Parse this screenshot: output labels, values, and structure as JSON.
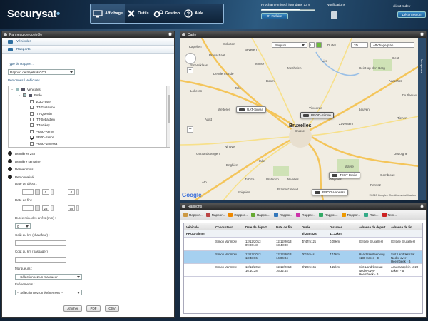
{
  "header": {
    "logo": "Securysat",
    "nav": {
      "display": "Affichage",
      "tools": "Outils",
      "manage": "Gestion",
      "help": "Aide"
    },
    "progress_text": "Prochaine mise à jour dans 13 s",
    "progress_fraction": 0.72,
    "reload_label": "Refaire",
    "notifications_label": "Notifications",
    "client_label": "client mdev",
    "logout_label": "Déconnexion"
  },
  "left_panel": {
    "title": "Panneau de contrôle",
    "vehicles_tab": "Véhicules",
    "reports_tab": "Rapports",
    "report_type_label": "Type de Rapport :",
    "report_type_value": "Rapport de trajets & CO2",
    "people_label": "Personnes / Véhicules :",
    "tree": [
      {
        "label": "Véhicules",
        "level": 0,
        "check": "part",
        "toggle": "-"
      },
      {
        "label": "Emile",
        "level": 1,
        "check": "part",
        "toggle": "-"
      },
      {
        "label": "103OTester",
        "level": 2,
        "check": "off",
        "toggle": ""
      },
      {
        "label": "ITT-Guillaume",
        "level": 2,
        "check": "off",
        "toggle": ""
      },
      {
        "label": "ITT-Quentin",
        "level": 2,
        "check": "off",
        "toggle": ""
      },
      {
        "label": "ITT-Sébastien",
        "level": 2,
        "check": "off",
        "toggle": ""
      },
      {
        "label": "ITT-Valery",
        "level": 2,
        "check": "off",
        "toggle": ""
      },
      {
        "label": "PROD-Remy",
        "level": 2,
        "check": "off",
        "toggle": ""
      },
      {
        "label": "PROD-Simon",
        "level": 2,
        "check": "on",
        "toggle": ""
      },
      {
        "label": "PROD-Vanessa",
        "level": 2,
        "check": "off",
        "toggle": ""
      }
    ],
    "periods": [
      "Dernières 24h",
      "Dernière semaine",
      "Dernier mois",
      "Personnalisé"
    ],
    "start_date_label": "Date de début :",
    "end_date_label": "Date de fin :",
    "start_hour": "0",
    "start_minute": "0",
    "end_hour": "23",
    "end_minute": "59",
    "min_duration_label": "Durée min. des arrêts (min) :",
    "min_duration_value": "0",
    "cost_driver_label": "Coût au km (chauffeur) :",
    "cost_passenger_label": "Coût au km (passager) :",
    "markers_label": "Marqueurs :",
    "markers_placeholder": "-- Sélectionnez un marqueur --",
    "events_label": "Événements :",
    "events_placeholder": "-- Sélectionnez un événement --",
    "btn_display": "Afficher",
    "btn_pdf": "PDF",
    "btn_csv": "CSV"
  },
  "map_panel": {
    "title": "Carte",
    "country": "Belgium",
    "view_mode": "2D",
    "display_plan": "Affichage plan",
    "side_label": "Marqueurs",
    "places": [
      "Kapellen",
      "Schoten",
      "Brasschaat",
      "Dendermonde",
      "Mechelen",
      "Lokeren",
      "Aalst",
      "Leuven",
      "Bruxelles",
      "Brussel",
      "Vilvoorde",
      "Zaventem",
      "Halle",
      "Wavre",
      "Nivelles",
      "Gembloux",
      "Braine-l'Alleud",
      "Ottignies",
      "Geraardsbergen",
      "Ninove",
      "Sint-Niklaas",
      "Lier",
      "Heist-op-den-Berg",
      "Aarschot",
      "Tienen",
      "Zoutleeuw",
      "Diest",
      "Beveren",
      "Temse",
      "Wetteren",
      "Zele",
      "Boom",
      "Duffel",
      "Perwez",
      "Jodoigne",
      "Waterloo",
      "Tubize",
      "Ath",
      "Enghien",
      "Soignies"
    ],
    "vehicles": [
      {
        "label": "UAT-Sirvan",
        "active": false
      },
      {
        "label": "PROD-Simon",
        "active": true
      },
      {
        "label": "TEST-Emile",
        "active": false
      },
      {
        "label": "PROD-Vanessa",
        "active": false
      }
    ],
    "copyright": "©2013 Google - Conditions d'utilisation",
    "google": "Google"
  },
  "reports_panel": {
    "title": "Rapports",
    "tabs": [
      "Rappor...",
      "Rappor...",
      "Rappor...",
      "Rappor...",
      "Rappor...",
      "Rappor...",
      "Rappor...",
      "Rappor...",
      "Rap...",
      "Tem..."
    ],
    "columns": [
      "Véhicule",
      "Conducteur",
      "Date de départ",
      "Date de fin",
      "Durée",
      "Distance",
      "Adresse de départ",
      "Adresse de fin"
    ],
    "group": {
      "vehicle": "PROD-Simon",
      "duration": "5h23m32s",
      "distance": "11.32km"
    },
    "rows": [
      {
        "driver": "Simon Vanmow",
        "start": "12/12/2013 09:00:48",
        "end": "12/12/2013 13:48:00",
        "duration": "4h47m12s",
        "distance": "0.00km",
        "start_addr": "[Entrée Bruxelles]",
        "end_addr": "[Entrée Bruxelles]",
        "selected": false
      },
      {
        "driver": "Simon Vanmow",
        "start": "12/12/2013 13:48:06",
        "end": "12/12/2013 14:04:04",
        "duration": "0h16m4s",
        "distance": "7.11km",
        "start_addr": "Haachtsesteenweg 1130 Haren - B",
        "end_addr": "Sint Landrikstraat Neder-over-Heembeek - B",
        "selected": true
      },
      {
        "driver": "Simon Vanmow",
        "start": "12/12/2013 16:10:28",
        "end": "12/12/2013 16:32:44",
        "duration": "0h22m16s",
        "distance": "4.22km",
        "start_addr": "Sint Landrikstraat Neder-over-Heembeek - B",
        "end_addr": "Araucariaplein 1020 Laken - B",
        "selected": false
      }
    ]
  },
  "colors": {
    "accent": "#1b5e95",
    "selected_row": "#a6d0f0",
    "panel_header": "#2a2a2a"
  }
}
